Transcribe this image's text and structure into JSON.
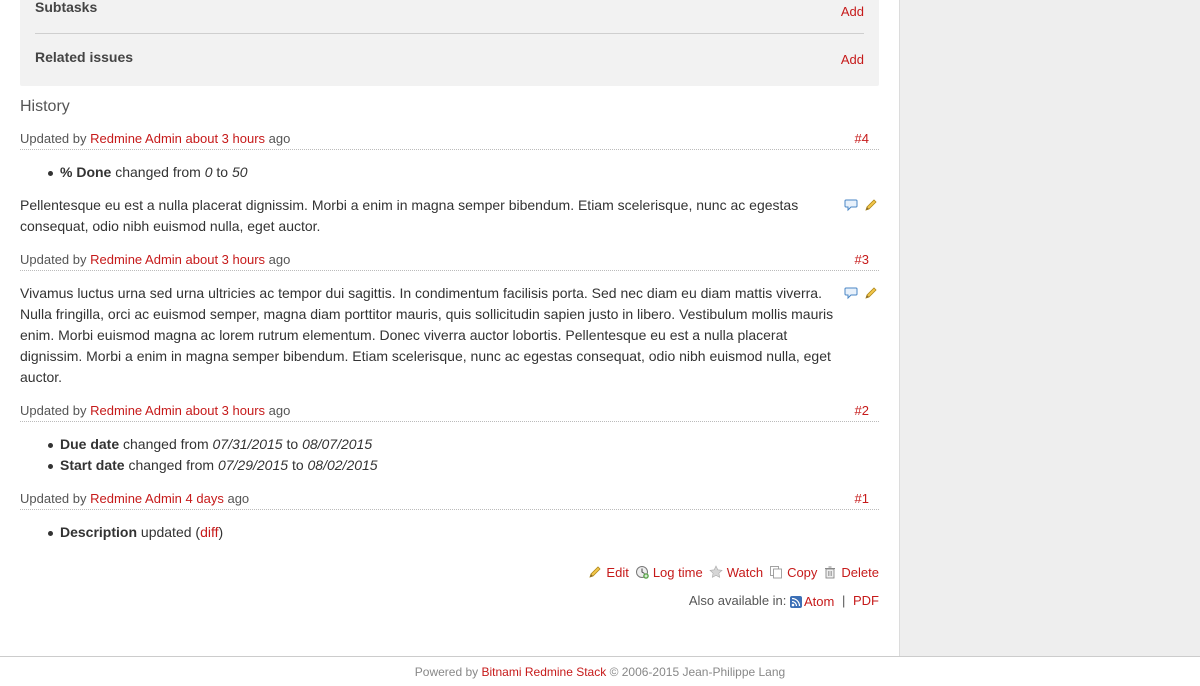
{
  "relations": {
    "subtasks_label": "Subtasks",
    "subtasks_add": "Add",
    "related_label": "Related issues",
    "related_add": "Add"
  },
  "history": {
    "title": "History",
    "journals": [
      {
        "prefix": "Updated by",
        "author": "Redmine Admin",
        "time": "about 3 hours",
        "suffix": "ago",
        "number": "#4",
        "details": [
          {
            "field": "% Done",
            "verb": "changed from",
            "from": "0",
            "to_word": "to",
            "to": "50"
          }
        ],
        "note": "Pellentesque eu est a nulla placerat dignissim. Morbi a enim in magna semper bibendum. Etiam scelerisque, nunc ac egestas consequat, odio nibh euismod nulla, eget auctor."
      },
      {
        "prefix": "Updated by",
        "author": "Redmine Admin",
        "time": "about 3 hours",
        "suffix": "ago",
        "number": "#3",
        "note": "Vivamus luctus urna sed urna ultricies ac tempor dui sagittis. In condimentum facilisis porta. Sed nec diam eu diam mattis viverra. Nulla fringilla, orci ac euismod semper, magna diam porttitor mauris, quis sollicitudin sapien justo in libero. Vestibulum mollis mauris enim. Morbi euismod magna ac lorem rutrum elementum. Donec viverra auctor lobortis. Pellentesque eu est a nulla placerat dignissim. Morbi a enim in magna semper bibendum. Etiam scelerisque, nunc ac egestas consequat, odio nibh euismod nulla, eget auctor."
      },
      {
        "prefix": "Updated by",
        "author": "Redmine Admin",
        "time": "about 3 hours",
        "suffix": "ago",
        "number": "#2",
        "details": [
          {
            "field": "Due date",
            "verb": "changed from",
            "from": "07/31/2015",
            "to_word": "to",
            "to": "08/07/2015"
          },
          {
            "field": "Start date",
            "verb": "changed from",
            "from": "07/29/2015",
            "to_word": "to",
            "to": "08/02/2015"
          }
        ]
      },
      {
        "prefix": "Updated by",
        "author": "Redmine Admin",
        "time": "4 days",
        "suffix": "ago",
        "number": "#1",
        "desc": {
          "field": "Description",
          "verb": "updated (",
          "link": "diff",
          "close": ")"
        }
      }
    ]
  },
  "actions": {
    "edit": "Edit",
    "log_time": "Log time",
    "watch": "Watch",
    "copy": "Copy",
    "delete": "Delete"
  },
  "formats": {
    "label": "Also available in:",
    "atom": "Atom",
    "separator": "|",
    "pdf": "PDF"
  },
  "footer": {
    "powered_by": "Powered by",
    "product": "Bitnami Redmine Stack",
    "copyright": "© 2006-2015 Jean-Philippe Lang"
  },
  "colors": {
    "link": "#c61a1a",
    "sidebar_bg": "#eeeeee",
    "relations_bg": "#f2f2f2"
  }
}
